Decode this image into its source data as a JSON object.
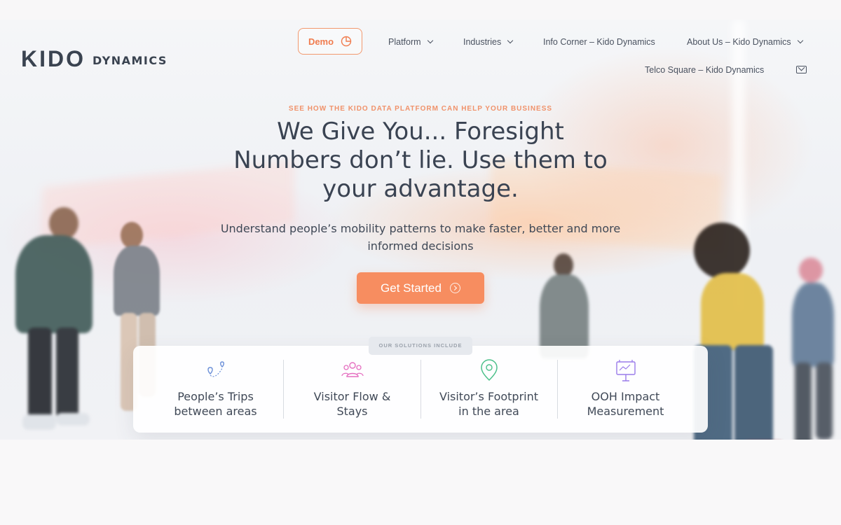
{
  "header": {
    "logo_mark": "KIDO",
    "logo_sub": "DYNAMICS"
  },
  "nav": {
    "demo": "Demo",
    "platform": "Platform",
    "industries": "Industries",
    "info_corner": "Info Corner – Kido Dynamics",
    "about_us": "About Us – Kido Dynamics",
    "telco_square": "Telco Square – Kido Dynamics"
  },
  "hero": {
    "eyebrow": "SEE HOW THE KIDO DATA PLATFORM CAN HELP YOUR BUSINESS",
    "headline_1": "We Give You... Foresight",
    "headline_2": "Numbers don’t lie. Use them to",
    "headline_3": "your advantage.",
    "subline_1": "Understand people’s mobility patterns to make faster, better and more",
    "subline_2": "informed decisions",
    "cta": "Get Started"
  },
  "solutions": {
    "tag": "OUR SOLUTIONS INCLUDE",
    "items": [
      {
        "line1": "People’s Trips",
        "line2": "between areas",
        "icon": "map-pins-route-icon"
      },
      {
        "line1": "Visitor Flow &",
        "line2": "Stays",
        "icon": "people-group-icon"
      },
      {
        "line1": "Visitor’s Footprint",
        "line2": "in the area",
        "icon": "location-pin-icon"
      },
      {
        "line1": "OOH Impact",
        "line2": "Measurement",
        "icon": "billboard-icon"
      }
    ]
  },
  "colors": {
    "accent": "#f78d60",
    "text": "#3c4654",
    "icon_blue": "#6b8fd8",
    "icon_pink": "#e56fc0",
    "icon_green": "#4cc08a",
    "icon_purple": "#9a7bea"
  }
}
